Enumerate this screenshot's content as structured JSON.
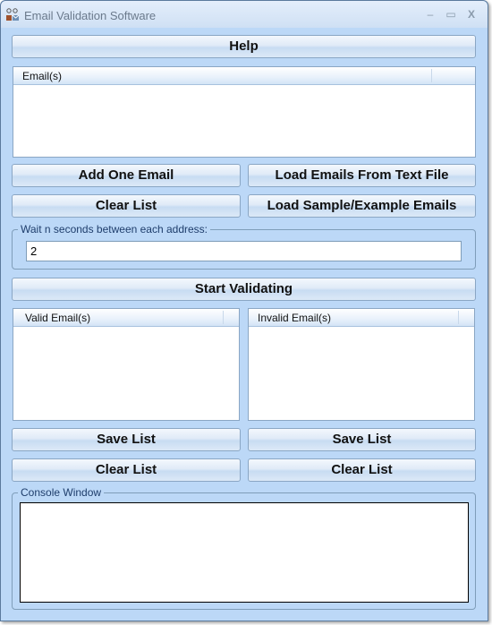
{
  "window": {
    "title": "Email Validation Software",
    "icon": "app-envelope-icon",
    "controls": {
      "minimize": "–",
      "maximize": "▭",
      "close": "X"
    }
  },
  "help_button": "Help",
  "emails_list": {
    "column": "Email(s)",
    "items": []
  },
  "email_buttons": {
    "add_one": "Add One Email",
    "load_file": "Load Emails From Text File",
    "clear": "Clear List",
    "load_sample": "Load Sample/Example Emails"
  },
  "wait_group": {
    "legend": "Wait n seconds between each address:",
    "value": "2"
  },
  "start_button": "Start Validating",
  "valid_list": {
    "column": "Valid Email(s)",
    "items": []
  },
  "invalid_list": {
    "column": "Invalid Email(s)",
    "items": []
  },
  "valid_buttons": {
    "save": "Save List",
    "clear": "Clear List"
  },
  "invalid_buttons": {
    "save": "Save List",
    "clear": "Clear List"
  },
  "console": {
    "legend": "Console Window",
    "text": ""
  }
}
